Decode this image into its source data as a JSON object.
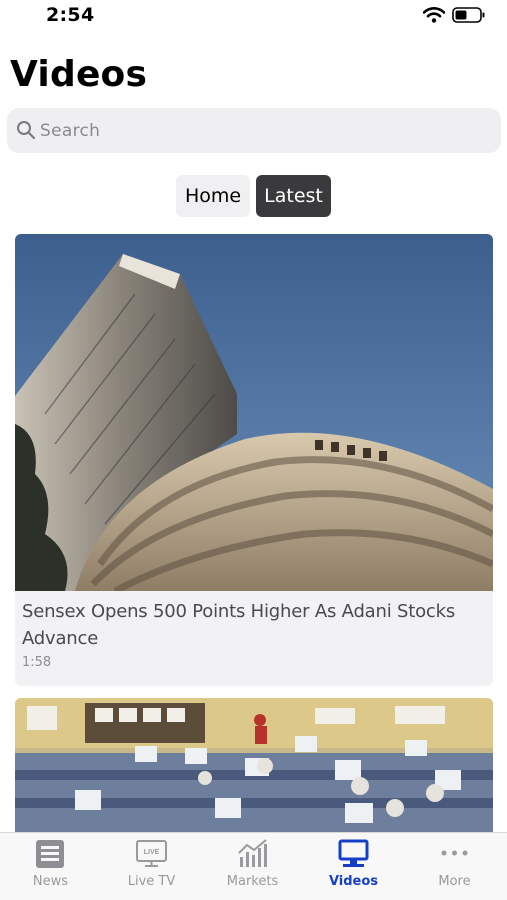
{
  "status_bar": {
    "time": "2:54"
  },
  "page": {
    "title": "Videos"
  },
  "search": {
    "placeholder": "Search",
    "value": ""
  },
  "segments": {
    "home_label": "Home",
    "latest_label": "Latest",
    "selected": "Latest"
  },
  "videos": [
    {
      "title": "Sensex Opens 500 Points Higher As Adani Stocks Advance",
      "duration": "1:58"
    },
    {
      "title": "",
      "duration": ""
    }
  ],
  "tab_bar": {
    "items": [
      {
        "label": "News",
        "icon": "news-icon"
      },
      {
        "label": "Live TV",
        "icon": "live-tv-icon"
      },
      {
        "label": "Markets",
        "icon": "markets-icon"
      },
      {
        "label": "Videos",
        "icon": "videos-icon"
      },
      {
        "label": "More",
        "icon": "more-icon"
      }
    ],
    "active": "Videos"
  },
  "colors": {
    "accent": "#1440c8",
    "selected_segment": "#3a3a3c",
    "inactive": "#9a9a9e"
  }
}
